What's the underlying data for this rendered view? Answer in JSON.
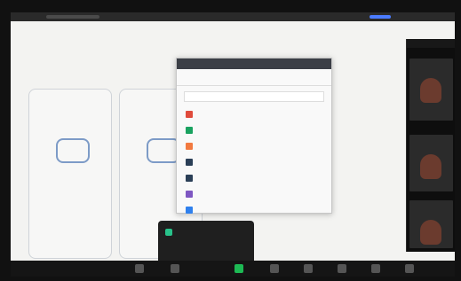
{
  "colors": {
    "accent_blue": "#5a7fb8",
    "green": "#1db954",
    "teal": "#28c28a",
    "bg_dark": "#111111"
  },
  "slide": {
    "title_line1": "",
    "title_line2": "",
    "columns": [
      {
        "num": "",
        "head": "",
        "body": "",
        "foot": ""
      },
      {
        "num": "",
        "head": "",
        "body": "",
        "foot": ""
      }
    ]
  },
  "picker": {
    "window_title": "",
    "tabs": [
      {
        "label": ""
      },
      {
        "label": ""
      }
    ],
    "search_placeholder": "",
    "items": [
      {
        "label": "",
        "color": "#e04b3c"
      },
      {
        "label": "",
        "color": "#1aa260"
      },
      {
        "label": "",
        "color": "#f27a40"
      },
      {
        "label": "",
        "color": "#2b3f57"
      },
      {
        "label": "",
        "color": "#2b3f57"
      },
      {
        "label": "",
        "color": "#7e57c2"
      },
      {
        "label": "",
        "color": "#2f80ed"
      }
    ]
  },
  "toast": {
    "line1": "",
    "line2": ""
  },
  "participants_panel": {
    "tiles": [
      {
        "name": ""
      },
      {
        "name": ""
      },
      {
        "name": ""
      }
    ]
  },
  "bottom_bar": {
    "buttons": [
      {
        "icon": "mic-icon",
        "color": "#555555"
      },
      {
        "icon": "video-icon",
        "color": "#555555"
      },
      {
        "icon": "share-icon",
        "color": "#1db954"
      },
      {
        "icon": "participants-icon",
        "color": "#555555"
      },
      {
        "icon": "chat-icon",
        "color": "#555555"
      },
      {
        "icon": "record-icon",
        "color": "#555555"
      },
      {
        "icon": "reactions-icon",
        "color": "#555555"
      },
      {
        "icon": "end-icon",
        "color": "#555555"
      }
    ]
  }
}
